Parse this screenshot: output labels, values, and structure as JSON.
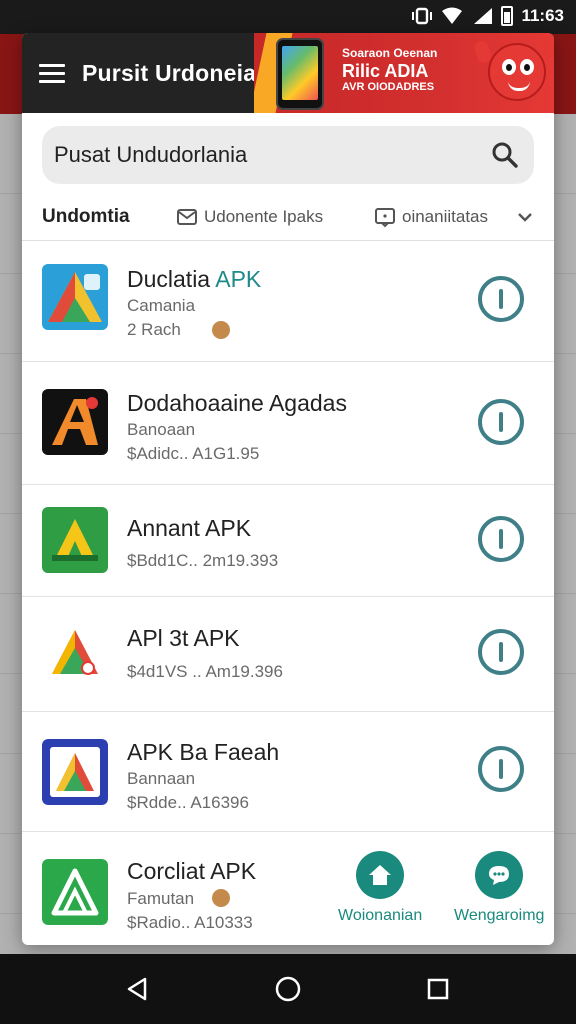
{
  "status_bar": {
    "time": "11:63"
  },
  "header": {
    "title": "Pursit Urdoneia"
  },
  "promo": {
    "line1": "Soaraon Oeenan",
    "line2": "Rilic ADIA",
    "line3": "AVR OIODADRES"
  },
  "search": {
    "value": "Pusat Undudorlania"
  },
  "filters": {
    "category": "Undomtia",
    "chip1": "Udonente Ipaks",
    "chip2": "oinaniitatas"
  },
  "apps": [
    {
      "name": "Duclatia",
      "name_suffix": "APK",
      "subtitle": "Camania",
      "meta": "2 Rach",
      "has_dot": true
    },
    {
      "name": "Dodahoaaine Agadas",
      "name_suffix": "",
      "subtitle": "Banoaan",
      "meta": "$Adidc.. A1G1.95",
      "has_dot": false
    },
    {
      "name": "Annant APK",
      "name_suffix": "",
      "subtitle": "",
      "meta": "$Bdd1C.. 2m19.393",
      "has_dot": false
    },
    {
      "name": "APl 3t APK",
      "name_suffix": "",
      "subtitle": "",
      "meta": "$4d1VS .. Am19.396",
      "has_dot": false
    },
    {
      "name": "APK  Ba Faeah",
      "name_suffix": "",
      "subtitle": "Bannaan",
      "meta": "$Rdde.. A16396",
      "has_dot": false
    },
    {
      "name": "Corcliat APK",
      "name_suffix": "",
      "subtitle": "Famutan",
      "meta": "$Radio.. A10333",
      "has_dot": true
    }
  ],
  "bottom_actions": {
    "left_label": "Woionanian",
    "right_label": "Wengaroimg"
  },
  "colors": {
    "accent": "#1b8a7e",
    "action_ring": "#3f8088",
    "banner_red": "#d32f2f",
    "header_dark": "#232323"
  }
}
